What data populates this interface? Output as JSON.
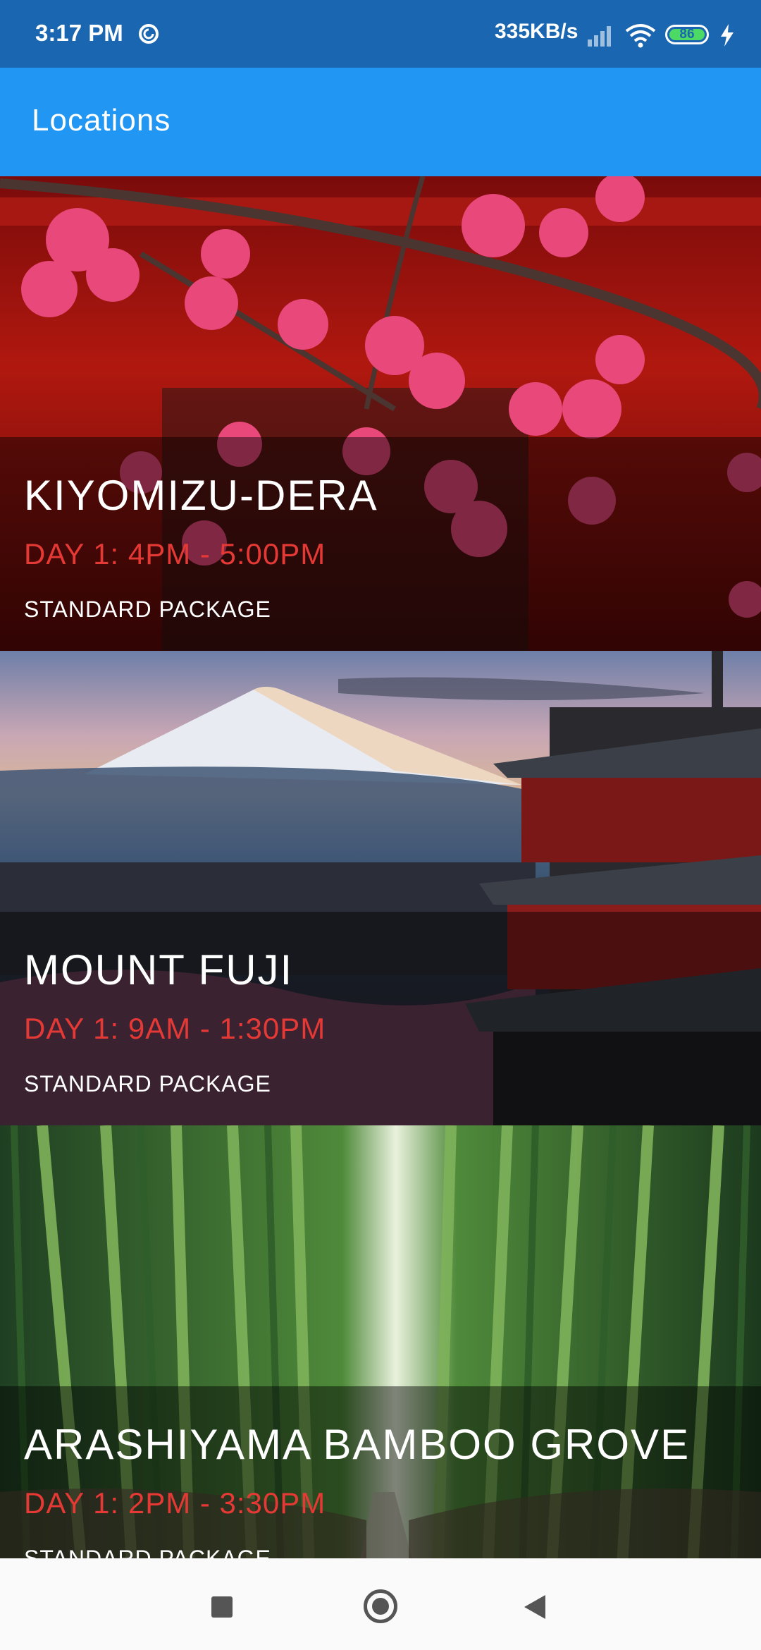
{
  "status_bar": {
    "time": "3:17 PM",
    "network_speed": "335KB/s",
    "battery_level": "86",
    "icons": [
      "do-not-disturb-icon",
      "signal-icon",
      "wifi-icon",
      "battery-icon",
      "charging-icon"
    ]
  },
  "app_bar": {
    "title": "Locations"
  },
  "locations": [
    {
      "name": "KIYOMIZU-DERA",
      "time": "DAY 1: 4PM - 5:00PM",
      "package": "STANDARD PACKAGE"
    },
    {
      "name": "MOUNT FUJI",
      "time": "DAY 1: 9AM - 1:30PM",
      "package": "STANDARD PACKAGE"
    },
    {
      "name": "ARASHIYAMA BAMBOO GROVE",
      "time": "DAY 1: 2PM - 3:30PM",
      "package": "STANDARD PACKAGE"
    }
  ],
  "colors": {
    "status_bar": "#1b66b0",
    "app_bar": "#2196f3",
    "time_text": "#e53935"
  },
  "nav_bar": {
    "icons": [
      "recents-icon",
      "home-icon",
      "back-icon"
    ]
  }
}
